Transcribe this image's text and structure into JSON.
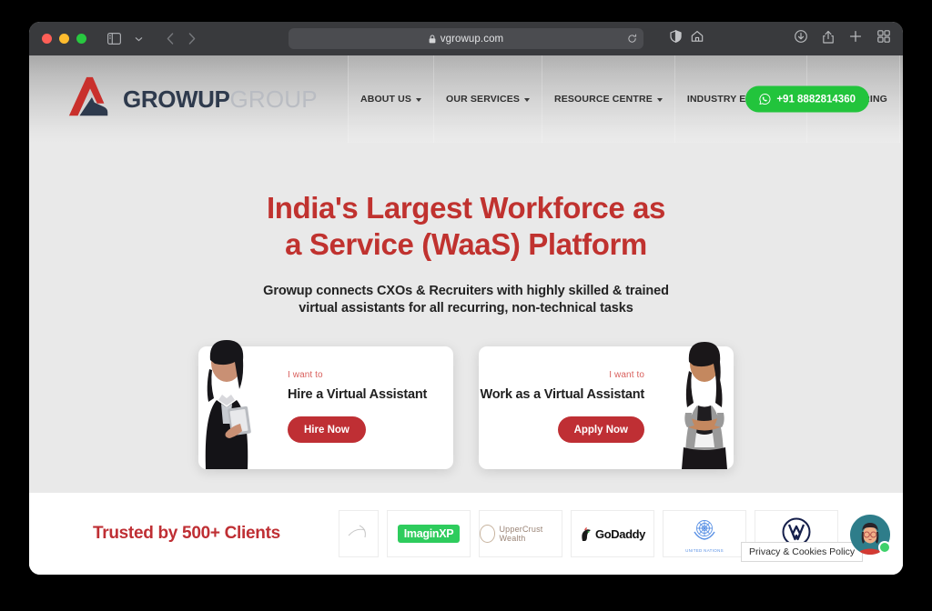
{
  "browser": {
    "url": "vgrowup.com",
    "icons": {
      "sidebar": "sidebar-icon",
      "sidebar_chevron": "chevron-down-icon",
      "back": "back-arrow-icon",
      "forward": "forward-arrow-icon",
      "lock": "lock-icon",
      "reload": "reload-icon",
      "reader": "reader-mode-icon",
      "home": "home-icon",
      "downloads": "downloads-icon",
      "share": "share-icon",
      "new_tab": "plus-icon",
      "tab_overview": "tab-overview-icon"
    }
  },
  "site": {
    "logo": {
      "primary": "GROWUP",
      "secondary": "GROUP"
    },
    "nav": [
      {
        "label": "ABOUT US",
        "has_dropdown": true
      },
      {
        "label": "OUR SERVICES",
        "has_dropdown": true
      },
      {
        "label": "RESOURCE CENTRE",
        "has_dropdown": true
      },
      {
        "label": "INDUSTRY EXPERTISE",
        "has_dropdown": false
      },
      {
        "label": "WE'RE HIRING",
        "has_dropdown": false
      }
    ],
    "whatsapp": {
      "label": "+91 8882814360",
      "color": "#22c43c"
    },
    "hero": {
      "headline_line1": "India's Largest Workforce as",
      "headline_line2": "a Service (WaaS) Platform",
      "headline_color": "#c0322f",
      "sub_line1": "Growup connects CXOs & Recruiters with highly skilled & trained",
      "sub_line2": "virtual assistants for all recurring, non-technical tasks"
    },
    "cards": [
      {
        "eyebrow": "I want to",
        "title": "Hire a Virtual Assistant",
        "cta": "Hire Now",
        "cta_color": "#bf2f34"
      },
      {
        "eyebrow": "I want to",
        "title": "Work as a Virtual Assistant",
        "cta": "Apply Now",
        "cta_color": "#bf2f34"
      }
    ],
    "trusted": {
      "title": "Trusted by 500+ Clients",
      "title_color": "#bf2f34",
      "logos": [
        {
          "name": "partial-logo",
          "text": ""
        },
        {
          "name": "imaginxp-logo",
          "text": "ImaginXP"
        },
        {
          "name": "uppercrust-wealth-logo",
          "text": "UpperCrust Wealth"
        },
        {
          "name": "godaddy-logo",
          "text": "GoDaddy"
        },
        {
          "name": "united-nations-logo",
          "text": "UNITED NATIONS"
        },
        {
          "name": "volkswagen-logo",
          "text": ""
        }
      ]
    },
    "cookie_tooltip": "Privacy & Cookies Policy"
  }
}
